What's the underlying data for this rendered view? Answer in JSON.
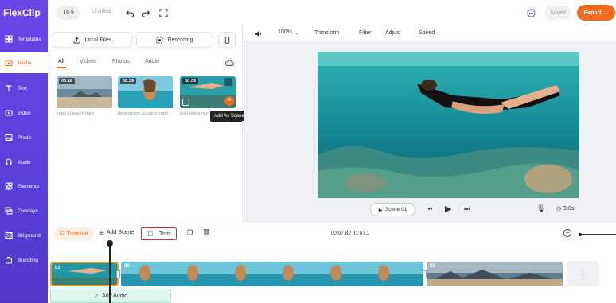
{
  "app": {
    "logo_text": "FlexClip"
  },
  "sidebar": {
    "items": [
      {
        "label": "Templates",
        "icon": "templates-icon"
      },
      {
        "label": "Media",
        "icon": "media-icon",
        "active": true
      },
      {
        "label": "Text",
        "icon": "text-icon"
      },
      {
        "label": "Video",
        "icon": "video-icon"
      },
      {
        "label": "Photo",
        "icon": "photo-icon"
      },
      {
        "label": "Audio",
        "icon": "audio-icon"
      },
      {
        "label": "Elements",
        "icon": "elements-icon"
      },
      {
        "label": "Overlays",
        "icon": "overlays-icon"
      },
      {
        "label": "BKground",
        "icon": "background-icon"
      },
      {
        "label": "Branding",
        "icon": "branding-icon"
      }
    ]
  },
  "topbar": {
    "aspect_ratio": "16:9",
    "project_title": "Untitled",
    "saved_label": "Saved",
    "export_label": "Export →"
  },
  "media_panel": {
    "local_files_label": "Local Files",
    "recording_label": "Recording",
    "tabs": [
      "All",
      "Videos",
      "Photos",
      "Audio"
    ],
    "active_tab": "All",
    "items": [
      {
        "duration": "00:18",
        "filename": "yoga at beach.mp4"
      },
      {
        "duration": "00:39",
        "filename": "honeymoon vacation.mp4"
      },
      {
        "duration": "00:09",
        "filename": "snorkeling.mp4"
      }
    ],
    "tooltip": "Add As Scene"
  },
  "edit_toolbar": {
    "zoom": "100%",
    "tools": [
      "Transform",
      "Filter",
      "Adjust",
      "Speed"
    ]
  },
  "preview": {
    "scene_label": "Scene 01",
    "duration": "9.0s"
  },
  "timeline": {
    "toggle_label": "Timeline",
    "add_scene_label": "Add Scene",
    "trim_label": "Trim",
    "time_readout": "00:07.8 / 01:07.1",
    "clips": [
      "01",
      "02",
      "03"
    ],
    "add_audio_label": "Add Audio",
    "add_clip_label": "+"
  },
  "colors": {
    "accent": "#f26b1d",
    "sidebar": "#5b3fd9",
    "highlight": "#e0282f"
  }
}
